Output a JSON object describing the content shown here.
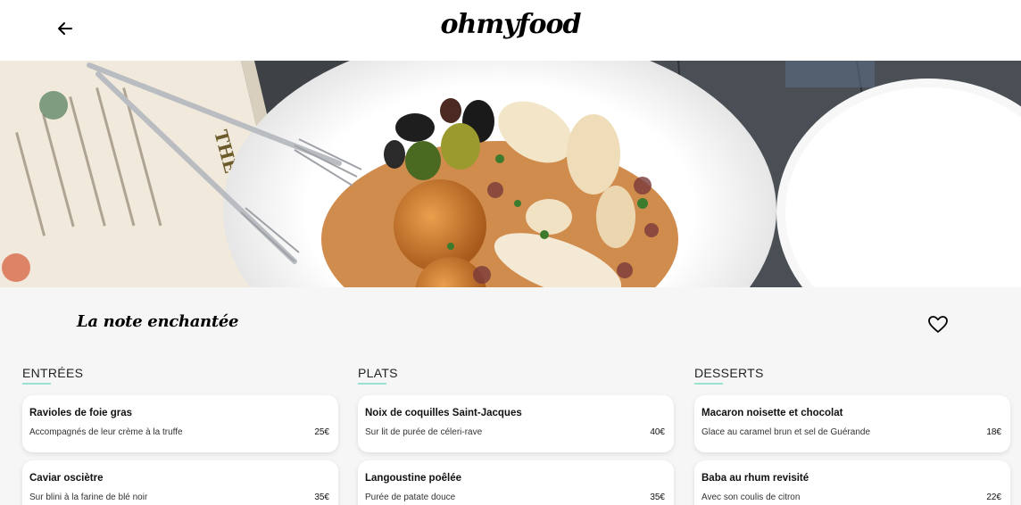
{
  "header": {
    "logo": "ohmyfood",
    "back_icon": "arrow-left-icon"
  },
  "restaurant": {
    "name": "La note enchantée",
    "favorite_icon": "heart-outline-icon"
  },
  "hero": {
    "menu_card_text": "THE BITE"
  },
  "colors": {
    "accent_underline": "#99e2d0",
    "background": "#f6f6f6",
    "card": "#ffffff"
  },
  "menu": {
    "columns": [
      {
        "title": "ENTRÉES",
        "items": [
          {
            "name": "Ravioles de foie gras",
            "desc": "Accompagnés de leur crème à la truffe",
            "price": "25€"
          },
          {
            "name": "Caviar osciètre",
            "desc": "Sur blini à la farine de blé noir",
            "price": "35€"
          }
        ]
      },
      {
        "title": "PLATS",
        "items": [
          {
            "name": "Noix de coquilles Saint-Jacques",
            "desc": "Sur lit de purée de céleri-rave",
            "price": "40€"
          },
          {
            "name": "Langoustine poêlée",
            "desc": "Purée de patate douce",
            "price": "35€"
          }
        ]
      },
      {
        "title": "DESSERTS",
        "items": [
          {
            "name": "Macaron noisette et chocolat",
            "desc": "Glace au caramel brun et sel de Guérande",
            "price": "18€"
          },
          {
            "name": "Baba au rhum revisité",
            "desc": "Avec son coulis de citron",
            "price": "22€"
          }
        ]
      }
    ]
  }
}
